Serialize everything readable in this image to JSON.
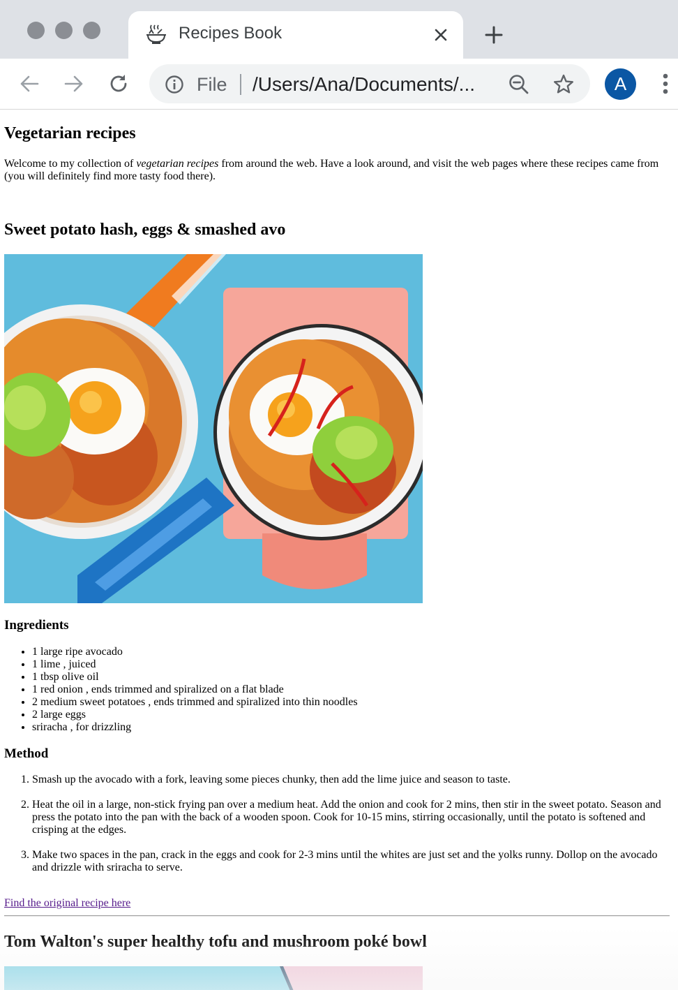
{
  "browser": {
    "tab": {
      "title": "Recipes Book",
      "icon": "bowl-steam-icon"
    },
    "new_tab_icon": "plus-icon",
    "omnibox": {
      "scheme_label": "File",
      "url_display": "/Users/Ana/Documents/..."
    },
    "profile_initial": "A",
    "colors": {
      "avatar": "#0b57a4",
      "tabstrip": "#dee1e6",
      "link": "#551a8b"
    }
  },
  "page": {
    "title": "Vegetarian recipes",
    "intro": {
      "before": "Welcome to my collection of ",
      "emphasis": "vegetarian recipes",
      "after": " from around the web. Have a look around, and visit the web pages where these recipes came from (you will definitely find more tasty food there)."
    },
    "recipes": [
      {
        "title": "Sweet potato hash, eggs & smashed avo",
        "ingredients_heading": "Ingredients",
        "ingredients": [
          "1 large ripe avocado",
          "1 lime , juiced",
          "1 tbsp olive oil",
          "1 red onion , ends trimmed and spiralized on a flat blade",
          "2 medium sweet potatoes , ends trimmed and spiralized into thin noodles",
          "2 large eggs",
          "sriracha , for drizzling"
        ],
        "method_heading": "Method",
        "method": [
          "Smash up the avocado with a fork, leaving some pieces chunky, then add the lime juice and season to taste.",
          "Heat the oil in a large, non-stick frying pan over a medium heat. Add the onion and cook for 2 mins, then stir in the sweet potato. Season and press the potato into the pan with the back of a wooden spoon. Cook for 10-15 mins, stirring occasionally, until the potato is softened and crisping at the edges.",
          "Make two spaces in the pan, crack in the eggs and cook for 2-3 mins until the whites are just set and the yolks runny. Dollop on the avocado and drizzle with sriracha to serve."
        ],
        "link_text": "Find the original recipe here"
      },
      {
        "title": "Tom Walton's super healthy tofu and mushroom poké bowl"
      }
    ]
  }
}
